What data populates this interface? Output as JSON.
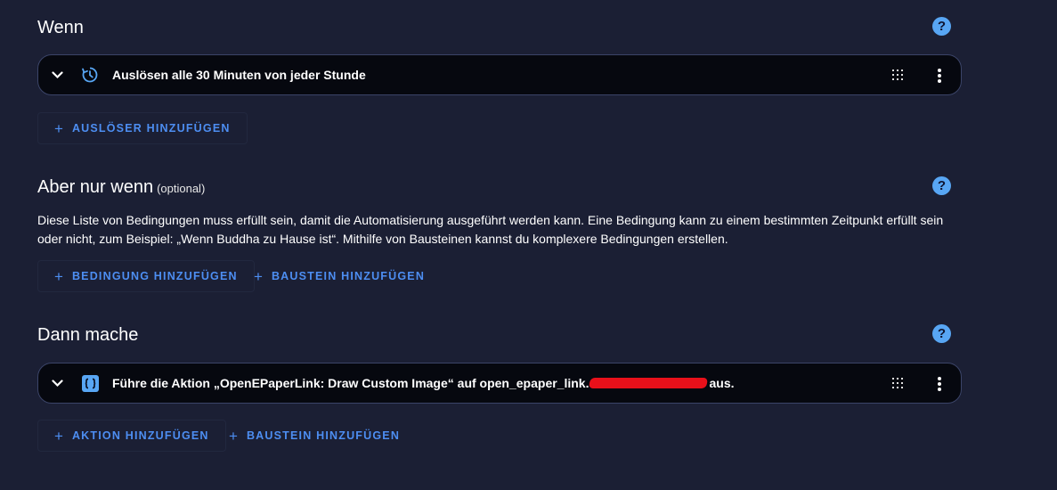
{
  "when": {
    "title": "Wenn",
    "help": "?",
    "trigger": {
      "label": "Auslösen alle 30 Minuten von jeder Stunde",
      "icon": "clock-trigger-icon"
    },
    "add_trigger": {
      "plus": "+",
      "label": "AUSLÖSER HINZUFÜGEN"
    }
  },
  "condition": {
    "title": "Aber nur wenn",
    "optional": "(optional)",
    "help": "?",
    "description_line1": "Diese Liste von Bedingungen muss erfüllt sein, damit die Automatisierung ausgeführt werden kann. Eine Bedingung kann zu einem bestimmten Zeitpunkt erfüllt sein",
    "description_line2": "oder nicht, zum Beispiel: „Wenn Buddha zu Hause ist“. Mithilfe von Bausteinen kannst du komplexere Bedingungen erstellen.",
    "add_condition": {
      "plus": "+",
      "label": "BEDINGUNG HINZUFÜGEN"
    },
    "add_block": {
      "plus": "+",
      "label": "BAUSTEIN HINZUFÜGEN"
    }
  },
  "then": {
    "title": "Dann mache",
    "help": "?",
    "action": {
      "label_prefix": "Führe die Aktion „OpenEPaperLink: Draw Custom Image“ auf open_epaper_link.",
      "label_suffix": " aus.",
      "icon": "code-braces-icon"
    },
    "add_action": {
      "plus": "+",
      "label": "AKTION HINZUFÜGEN"
    },
    "add_block": {
      "plus": "+",
      "label": "BAUSTEIN HINZUFÜGEN"
    }
  },
  "colors": {
    "background": "#1b1f34",
    "card": "#06080f",
    "accent": "#4d8ef2",
    "help": "#58a6f4",
    "redaction": "#e8101a"
  }
}
